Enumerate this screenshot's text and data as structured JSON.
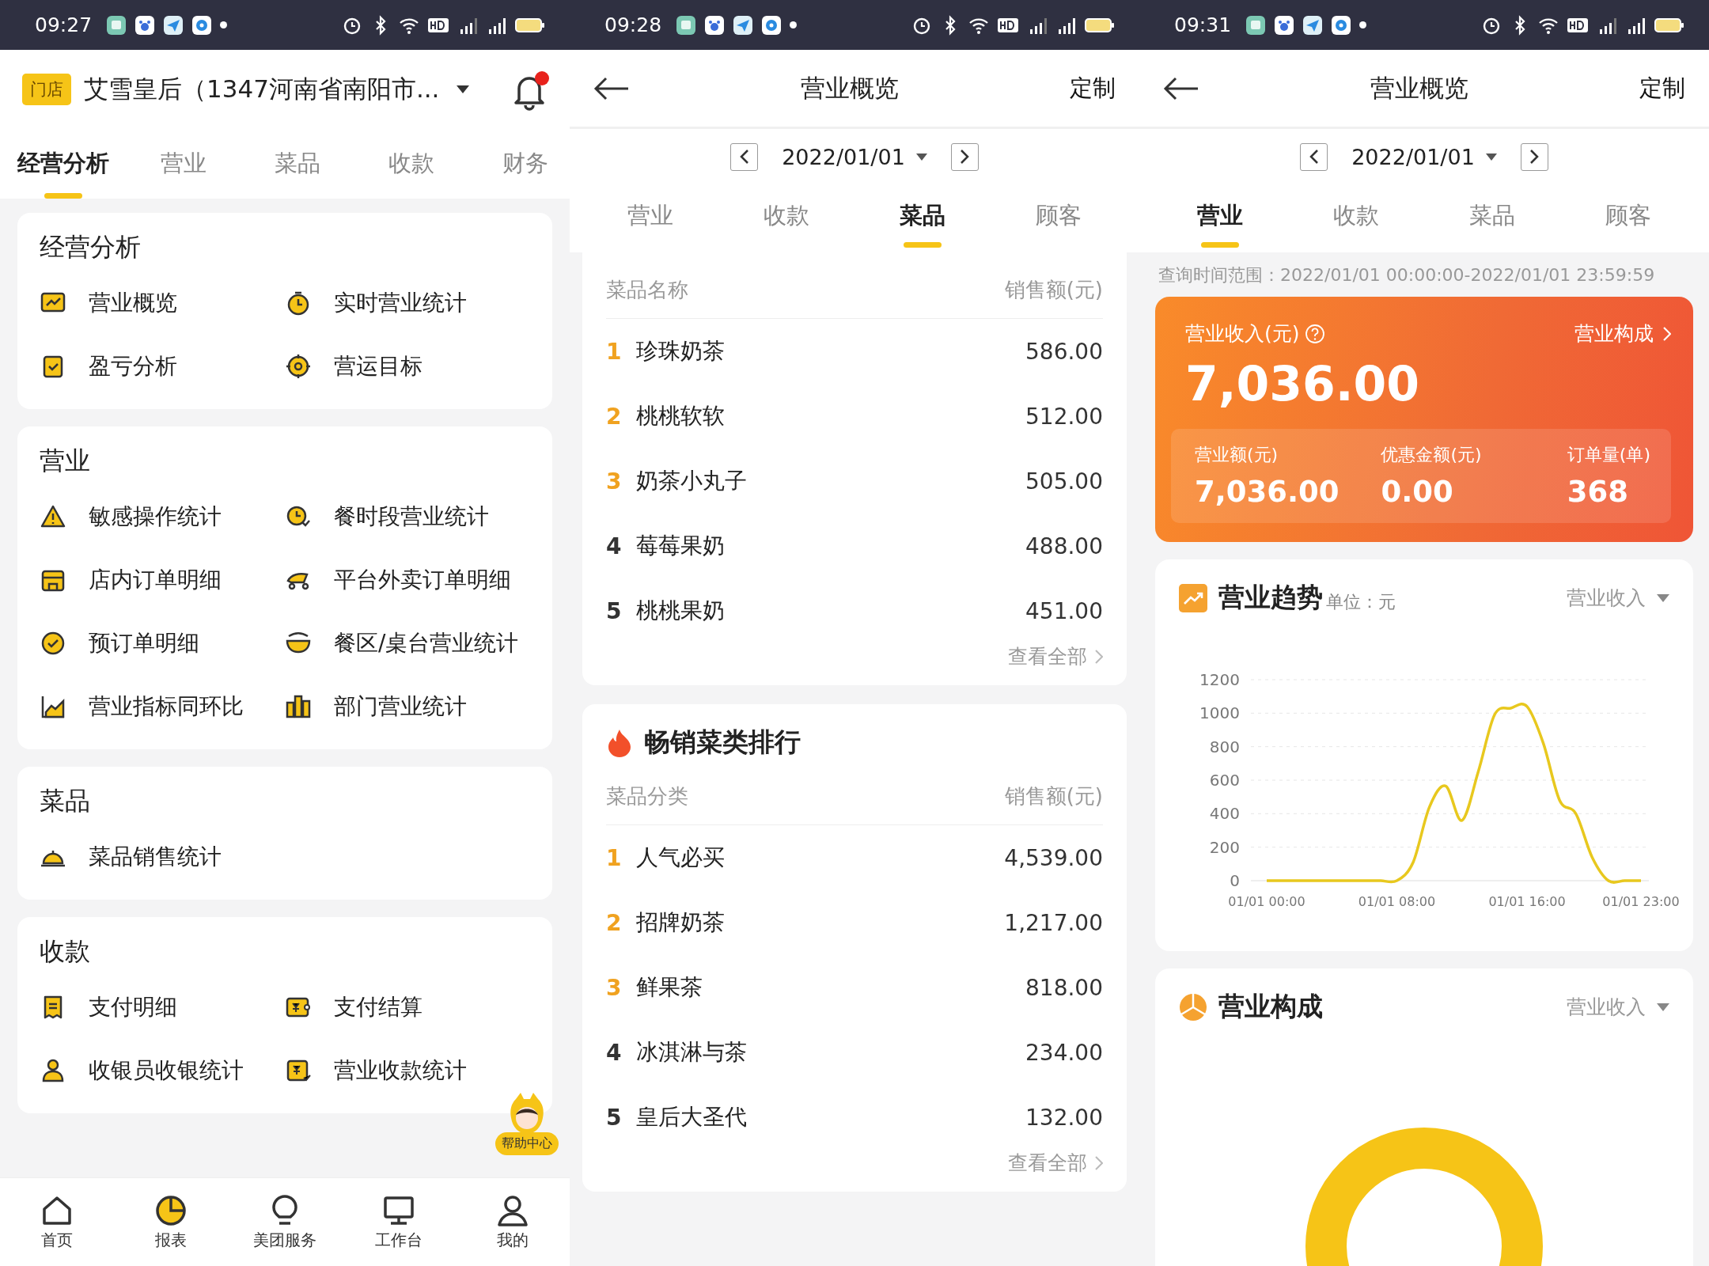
{
  "screens": [
    {
      "kind": "menu",
      "status_bar": {
        "time": "09:27"
      },
      "header": {
        "badge": "门店",
        "store_name": "艾雪皇后（1347河南省南阳市...",
        "unread": true
      },
      "tabs": [
        {
          "label": "经营分析",
          "selected": true
        },
        {
          "label": "营业",
          "selected": false
        },
        {
          "label": "菜品",
          "selected": false
        },
        {
          "label": "收款",
          "selected": false
        },
        {
          "label": "财务",
          "selected": false
        }
      ],
      "sections": [
        {
          "title": "经营分析",
          "items": [
            "营业概览",
            "实时营业统计",
            "盈亏分析",
            "营运目标"
          ]
        },
        {
          "title": "营业",
          "items": [
            "敏感操作统计",
            "餐时段营业统计",
            "店内订单明细",
            "平台外卖订单明细",
            "预订单明细",
            "餐区/桌台营业统计",
            "营业指标同环比",
            "部门营业统计"
          ]
        },
        {
          "title": "菜品",
          "items": [
            "菜品销售统计"
          ]
        },
        {
          "title": "收款",
          "items": [
            "支付明细",
            "支付结算",
            "收银员收银统计",
            "营业收款统计"
          ]
        }
      ],
      "help_badge": "帮助中心",
      "bottom_nav": [
        {
          "label": "首页",
          "selected": false
        },
        {
          "label": "报表",
          "selected": true
        },
        {
          "label": "美团服务",
          "selected": false
        },
        {
          "label": "工作台",
          "selected": false
        },
        {
          "label": "我的",
          "selected": false
        }
      ]
    },
    {
      "kind": "dishes",
      "status_bar": {
        "time": "09:28"
      },
      "header": {
        "title": "营业概览",
        "action": "定制"
      },
      "date": "2022/01/01",
      "tabs": [
        {
          "label": "营业",
          "selected": false
        },
        {
          "label": "收款",
          "selected": false
        },
        {
          "label": "菜品",
          "selected": true
        },
        {
          "label": "顾客",
          "selected": false
        }
      ],
      "rankings": [
        {
          "columns": [
            "菜品名称",
            "销售额(元)"
          ],
          "rows": [
            {
              "rank": "1",
              "name": "珍珠奶茶",
              "value": "586.00"
            },
            {
              "rank": "2",
              "name": "桃桃软软",
              "value": "512.00"
            },
            {
              "rank": "3",
              "name": "奶茶小丸子",
              "value": "505.00"
            },
            {
              "rank": "4",
              "name": "莓莓果奶",
              "value": "488.00"
            },
            {
              "rank": "5",
              "name": "桃桃果奶",
              "value": "451.00"
            }
          ],
          "more": "查看全部"
        },
        {
          "title": "畅销菜类排行",
          "columns": [
            "菜品分类",
            "销售额(元)"
          ],
          "rows": [
            {
              "rank": "1",
              "name": "人气必买",
              "value": "4,539.00"
            },
            {
              "rank": "2",
              "name": "招牌奶茶",
              "value": "1,217.00"
            },
            {
              "rank": "3",
              "name": "鲜果茶",
              "value": "818.00"
            },
            {
              "rank": "4",
              "name": "冰淇淋与茶",
              "value": "234.00"
            },
            {
              "rank": "5",
              "name": "皇后大圣代",
              "value": "132.00"
            }
          ],
          "more": "查看全部"
        }
      ]
    },
    {
      "kind": "overview",
      "status_bar": {
        "time": "09:31"
      },
      "header": {
        "title": "营业概览",
        "action": "定制"
      },
      "date": "2022/01/01",
      "tabs": [
        {
          "label": "营业",
          "selected": true
        },
        {
          "label": "收款",
          "selected": false
        },
        {
          "label": "菜品",
          "selected": false
        },
        {
          "label": "顾客",
          "selected": false
        }
      ],
      "query_range": "查询时间范围：2022/01/01 00:00:00-2022/01/01 23:59:59",
      "revenue": {
        "label": "营业收入(元)",
        "link": "营业构成",
        "total": "7,036.00",
        "stats": [
          {
            "label": "营业额(元)",
            "value": "7,036.00"
          },
          {
            "label": "优惠金额(元)",
            "value": "0.00"
          },
          {
            "label": "订单量(单)",
            "value": "368"
          }
        ]
      },
      "trend": {
        "title": "营业趋势",
        "unit": "单位：元",
        "dropdown": "营业收入",
        "chart_data": {
          "type": "line",
          "categories": [
            "01/01 00:00",
            null,
            null,
            null,
            null,
            null,
            null,
            null,
            "01/01 08:00",
            null,
            null,
            null,
            null,
            null,
            null,
            null,
            "01/01 16:00",
            null,
            null,
            null,
            null,
            null,
            null,
            "01/01 23:00"
          ],
          "series": [
            {
              "color": "#e8c81e",
              "values": [
                0,
                0,
                0,
                0,
                0,
                0,
                0,
                0,
                0,
                110,
                440,
                565,
                360,
                650,
                990,
                1030,
                1040,
                820,
                480,
                400,
                140,
                0,
                0,
                0
              ]
            }
          ],
          "ylim": [
            0,
            1200
          ],
          "grid": true,
          "yticks": [
            0,
            200,
            400,
            600,
            800,
            1000,
            1200
          ]
        }
      },
      "composition": {
        "title": "营业构成",
        "dropdown": "营业收入"
      }
    }
  ]
}
